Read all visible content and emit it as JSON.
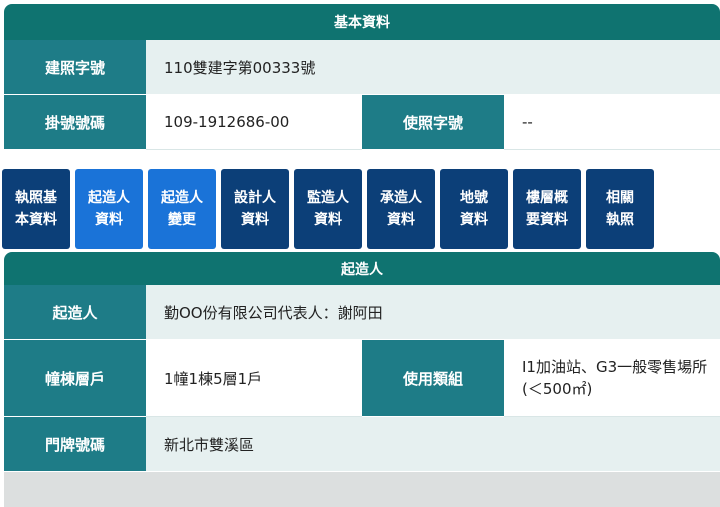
{
  "basic_info": {
    "header": "基本資料",
    "rows": [
      {
        "label": "建照字號",
        "value": "110雙建字第00333號"
      },
      {
        "label": "掛號號碼",
        "value": "109-1912686-00",
        "label2": "使照字號",
        "value2": "--"
      }
    ]
  },
  "tabs": [
    {
      "label": "執照基\n本資料"
    },
    {
      "label": "起造人\n資料"
    },
    {
      "label": "起造人\n變更"
    },
    {
      "label": "設計人\n資料"
    },
    {
      "label": "監造人\n資料"
    },
    {
      "label": "承造人\n資料"
    },
    {
      "label": "地號\n資料"
    },
    {
      "label": "樓層概\n要資料"
    },
    {
      "label": "相關\n執照"
    }
  ],
  "builder": {
    "header": "起造人",
    "rows": [
      {
        "label": "起造人",
        "value": "勤OO份有限公司代表人：謝阿田"
      },
      {
        "label": "幢棟層戶",
        "value": "1幢1棟5層1戶",
        "label2": "使用類組",
        "value2": "I1加油站、G3一般零售場所(＜500㎡)"
      },
      {
        "label": "門牌號碼",
        "value": "新北市雙溪區"
      }
    ]
  },
  "colors": {
    "header": "#0f7370",
    "label_cell": "#1e7c87",
    "tab": "#0c3f78",
    "tab_active": "#1a73d8"
  }
}
